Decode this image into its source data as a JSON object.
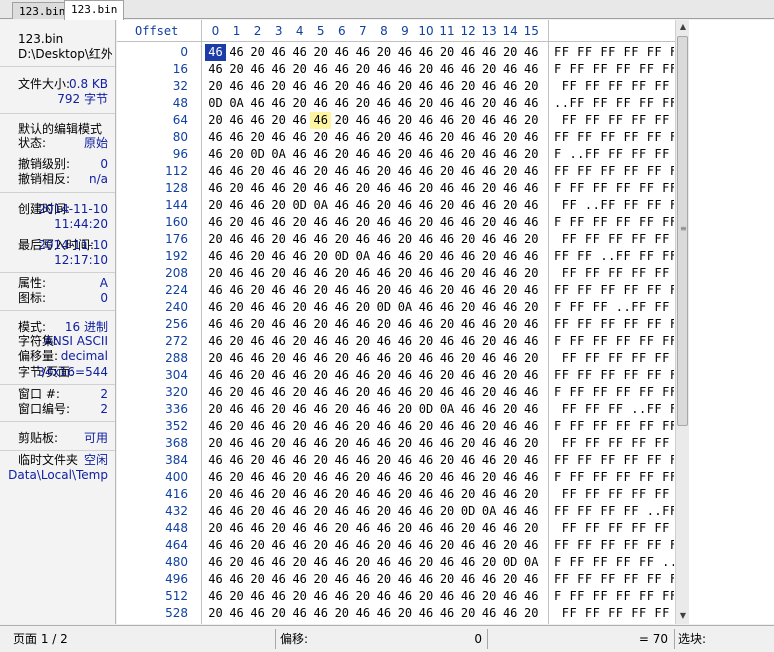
{
  "tabs": [
    {
      "label": "123.bin",
      "active": false
    },
    {
      "label": "123.bin",
      "active": true
    }
  ],
  "info": {
    "file_name": "123.bin",
    "file_path": "D:\\Desktop\\红外i",
    "file_size_label": "文件大小:",
    "file_size_kb": "0.8 KB",
    "file_size_bytes": "792 字节",
    "edit_mode_label": "默认的编辑模式",
    "state_label": "状态:",
    "state_value": "原始",
    "undo_level_label": "撤销级别:",
    "undo_level_value": "0",
    "undo_reverse_label": "撤销相反:",
    "undo_reverse_value": "n/a",
    "created_label": "创建时间:",
    "created_date": "2014-11-10",
    "created_time": "11:44:20",
    "last_write_label": "最后写入时间:",
    "last_write_date": "2014-11-10",
    "last_write_time": "12:17:10",
    "attributes_label": "属性:",
    "attributes_value": "A",
    "icon_label": "图标:",
    "icon_value": "0",
    "mode_label": "模式:",
    "mode_value": "16 进制",
    "charset_label": "字符集:",
    "charset_value": "ANSI ASCII",
    "offset_label": "偏移量:",
    "offset_value": "decimal",
    "bytes_per_page_label": "字节/页面:",
    "bytes_per_page_value": "34x16=544",
    "window_num_label": "窗口 #:",
    "window_num_value": "2",
    "window_count_label": "窗口编号:",
    "window_count_value": "2",
    "clipboard_label": "剪贴板:",
    "clipboard_value": "可用",
    "temp_folder_label": "临时文件夹",
    "temp_folder_space": "空闲",
    "temp_folder_path": "Data\\Local\\Temp"
  },
  "hex": {
    "offset_header": "Offset",
    "column_headers": [
      "0",
      "1",
      "2",
      "3",
      "4",
      "5",
      "6",
      "7",
      "8",
      "9",
      "10",
      "11",
      "12",
      "13",
      "14",
      "15"
    ],
    "rows": [
      {
        "offset": "0",
        "bytes": [
          "46",
          "46",
          "20",
          "46",
          "46",
          "20",
          "46",
          "46",
          "20",
          "46",
          "46",
          "20",
          "46",
          "46",
          "20",
          "46"
        ],
        "ascii": "FF FF FF FF FF F"
      },
      {
        "offset": "16",
        "bytes": [
          "46",
          "20",
          "46",
          "46",
          "20",
          "46",
          "46",
          "20",
          "46",
          "46",
          "20",
          "46",
          "46",
          "20",
          "46",
          "46"
        ],
        "ascii": "F FF FF FF FF FF"
      },
      {
        "offset": "32",
        "bytes": [
          "20",
          "46",
          "46",
          "20",
          "46",
          "46",
          "20",
          "46",
          "46",
          "20",
          "46",
          "46",
          "20",
          "46",
          "46",
          "20"
        ],
        "ascii": " FF FF FF FF FF "
      },
      {
        "offset": "48",
        "bytes": [
          "0D",
          "0A",
          "46",
          "46",
          "20",
          "46",
          "46",
          "20",
          "46",
          "46",
          "20",
          "46",
          "46",
          "20",
          "46",
          "46"
        ],
        "ascii": "..FF FF FF FF FF"
      },
      {
        "offset": "64",
        "bytes": [
          "20",
          "46",
          "46",
          "20",
          "46",
          "46",
          "20",
          "46",
          "46",
          "20",
          "46",
          "46",
          "20",
          "46",
          "46",
          "20"
        ],
        "ascii": " FF FF FF FF FF "
      },
      {
        "offset": "80",
        "bytes": [
          "46",
          "46",
          "20",
          "46",
          "46",
          "20",
          "46",
          "46",
          "20",
          "46",
          "46",
          "20",
          "46",
          "46",
          "20",
          "46"
        ],
        "ascii": "FF FF FF FF FF F"
      },
      {
        "offset": "96",
        "bytes": [
          "46",
          "20",
          "0D",
          "0A",
          "46",
          "46",
          "20",
          "46",
          "46",
          "20",
          "46",
          "46",
          "20",
          "46",
          "46",
          "20"
        ],
        "ascii": "F ..FF FF FF FF "
      },
      {
        "offset": "112",
        "bytes": [
          "46",
          "46",
          "20",
          "46",
          "46",
          "20",
          "46",
          "46",
          "20",
          "46",
          "46",
          "20",
          "46",
          "46",
          "20",
          "46"
        ],
        "ascii": "FF FF FF FF FF F"
      },
      {
        "offset": "128",
        "bytes": [
          "46",
          "20",
          "46",
          "46",
          "20",
          "46",
          "46",
          "20",
          "46",
          "46",
          "20",
          "46",
          "46",
          "20",
          "46",
          "46"
        ],
        "ascii": "F FF FF FF FF FF"
      },
      {
        "offset": "144",
        "bytes": [
          "20",
          "46",
          "46",
          "20",
          "0D",
          "0A",
          "46",
          "46",
          "20",
          "46",
          "46",
          "20",
          "46",
          "46",
          "20",
          "46"
        ],
        "ascii": " FF ..FF FF FF F"
      },
      {
        "offset": "160",
        "bytes": [
          "46",
          "20",
          "46",
          "46",
          "20",
          "46",
          "46",
          "20",
          "46",
          "46",
          "20",
          "46",
          "46",
          "20",
          "46",
          "46"
        ],
        "ascii": "F FF FF FF FF FF"
      },
      {
        "offset": "176",
        "bytes": [
          "20",
          "46",
          "46",
          "20",
          "46",
          "46",
          "20",
          "46",
          "46",
          "20",
          "46",
          "46",
          "20",
          "46",
          "46",
          "20"
        ],
        "ascii": " FF FF FF FF FF "
      },
      {
        "offset": "192",
        "bytes": [
          "46",
          "46",
          "20",
          "46",
          "46",
          "20",
          "0D",
          "0A",
          "46",
          "46",
          "20",
          "46",
          "46",
          "20",
          "46",
          "46"
        ],
        "ascii": "FF FF ..FF FF FF"
      },
      {
        "offset": "208",
        "bytes": [
          "20",
          "46",
          "46",
          "20",
          "46",
          "46",
          "20",
          "46",
          "46",
          "20",
          "46",
          "46",
          "20",
          "46",
          "46",
          "20"
        ],
        "ascii": " FF FF FF FF FF "
      },
      {
        "offset": "224",
        "bytes": [
          "46",
          "46",
          "20",
          "46",
          "46",
          "20",
          "46",
          "46",
          "20",
          "46",
          "46",
          "20",
          "46",
          "46",
          "20",
          "46"
        ],
        "ascii": "FF FF FF FF FF F"
      },
      {
        "offset": "240",
        "bytes": [
          "46",
          "20",
          "46",
          "46",
          "20",
          "46",
          "46",
          "20",
          "0D",
          "0A",
          "46",
          "46",
          "20",
          "46",
          "46",
          "20"
        ],
        "ascii": "F FF FF ..FF FF "
      },
      {
        "offset": "256",
        "bytes": [
          "46",
          "46",
          "20",
          "46",
          "46",
          "20",
          "46",
          "46",
          "20",
          "46",
          "46",
          "20",
          "46",
          "46",
          "20",
          "46"
        ],
        "ascii": "FF FF FF FF FF F"
      },
      {
        "offset": "272",
        "bytes": [
          "46",
          "20",
          "46",
          "46",
          "20",
          "46",
          "46",
          "20",
          "46",
          "46",
          "20",
          "46",
          "46",
          "20",
          "46",
          "46"
        ],
        "ascii": "F FF FF FF FF FF"
      },
      {
        "offset": "288",
        "bytes": [
          "20",
          "46",
          "46",
          "20",
          "46",
          "46",
          "20",
          "46",
          "46",
          "20",
          "46",
          "46",
          "20",
          "46",
          "46",
          "20"
        ],
        "ascii": " FF FF FF FF FF "
      },
      {
        "offset": "304",
        "bytes": [
          "46",
          "46",
          "20",
          "46",
          "46",
          "20",
          "46",
          "46",
          "20",
          "46",
          "46",
          "20",
          "46",
          "46",
          "20",
          "46"
        ],
        "ascii": "FF FF FF FF FF F"
      },
      {
        "offset": "320",
        "bytes": [
          "46",
          "20",
          "46",
          "46",
          "20",
          "46",
          "46",
          "20",
          "46",
          "46",
          "20",
          "46",
          "46",
          "20",
          "46",
          "46"
        ],
        "ascii": "F FF FF FF FF FF"
      },
      {
        "offset": "336",
        "bytes": [
          "20",
          "46",
          "46",
          "20",
          "46",
          "46",
          "20",
          "46",
          "46",
          "20",
          "0D",
          "0A",
          "46",
          "46",
          "20",
          "46"
        ],
        "ascii": " FF FF FF ..FF F"
      },
      {
        "offset": "352",
        "bytes": [
          "46",
          "20",
          "46",
          "46",
          "20",
          "46",
          "46",
          "20",
          "46",
          "46",
          "20",
          "46",
          "46",
          "20",
          "46",
          "46"
        ],
        "ascii": "F FF FF FF FF FF"
      },
      {
        "offset": "368",
        "bytes": [
          "20",
          "46",
          "46",
          "20",
          "46",
          "46",
          "20",
          "46",
          "46",
          "20",
          "46",
          "46",
          "20",
          "46",
          "46",
          "20"
        ],
        "ascii": " FF FF FF FF FF "
      },
      {
        "offset": "384",
        "bytes": [
          "46",
          "46",
          "20",
          "46",
          "46",
          "20",
          "46",
          "46",
          "20",
          "46",
          "46",
          "20",
          "46",
          "46",
          "20",
          "46"
        ],
        "ascii": "FF FF FF FF FF F"
      },
      {
        "offset": "400",
        "bytes": [
          "46",
          "20",
          "46",
          "46",
          "20",
          "46",
          "46",
          "20",
          "46",
          "46",
          "20",
          "46",
          "46",
          "20",
          "46",
          "46"
        ],
        "ascii": "F FF FF FF FF FF"
      },
      {
        "offset": "416",
        "bytes": [
          "20",
          "46",
          "46",
          "20",
          "46",
          "46",
          "20",
          "46",
          "46",
          "20",
          "46",
          "46",
          "20",
          "46",
          "46",
          "20"
        ],
        "ascii": " FF FF FF FF FF "
      },
      {
        "offset": "432",
        "bytes": [
          "46",
          "46",
          "20",
          "46",
          "46",
          "20",
          "46",
          "46",
          "20",
          "46",
          "46",
          "20",
          "0D",
          "0A",
          "46",
          "46"
        ],
        "ascii": "FF FF FF FF ..FF"
      },
      {
        "offset": "448",
        "bytes": [
          "20",
          "46",
          "46",
          "20",
          "46",
          "46",
          "20",
          "46",
          "46",
          "20",
          "46",
          "46",
          "20",
          "46",
          "46",
          "20"
        ],
        "ascii": " FF FF FF FF FF "
      },
      {
        "offset": "464",
        "bytes": [
          "46",
          "46",
          "20",
          "46",
          "46",
          "20",
          "46",
          "46",
          "20",
          "46",
          "46",
          "20",
          "46",
          "46",
          "20",
          "46"
        ],
        "ascii": "FF FF FF FF FF F"
      },
      {
        "offset": "480",
        "bytes": [
          "46",
          "20",
          "46",
          "46",
          "20",
          "46",
          "46",
          "20",
          "46",
          "46",
          "20",
          "46",
          "46",
          "20",
          "0D",
          "0A"
        ],
        "ascii": "F FF FF FF FF .."
      },
      {
        "offset": "496",
        "bytes": [
          "46",
          "46",
          "20",
          "46",
          "46",
          "20",
          "46",
          "46",
          "20",
          "46",
          "46",
          "20",
          "46",
          "46",
          "20",
          "46"
        ],
        "ascii": "FF FF FF FF FF F"
      },
      {
        "offset": "512",
        "bytes": [
          "46",
          "20",
          "46",
          "46",
          "20",
          "46",
          "46",
          "20",
          "46",
          "46",
          "20",
          "46",
          "46",
          "20",
          "46",
          "46"
        ],
        "ascii": "F FF FF FF FF FF"
      },
      {
        "offset": "528",
        "bytes": [
          "20",
          "46",
          "46",
          "20",
          "46",
          "46",
          "20",
          "46",
          "46",
          "20",
          "46",
          "46",
          "20",
          "46",
          "46",
          "20"
        ],
        "ascii": " FF FF FF FF FF "
      }
    ]
  },
  "status": {
    "page": "页面 1 / 2",
    "offset_label": "偏移:",
    "offset_value": "0",
    "value": "= 70",
    "selection_label": "选块:"
  },
  "colors": {
    "offset_blue": "#1040a0",
    "cursor_bg": "#1c3ca8",
    "highlight": "#fff5a0"
  },
  "icons": {
    "scroll_up": "▲",
    "scroll_down": "▼",
    "grip": "≡"
  }
}
